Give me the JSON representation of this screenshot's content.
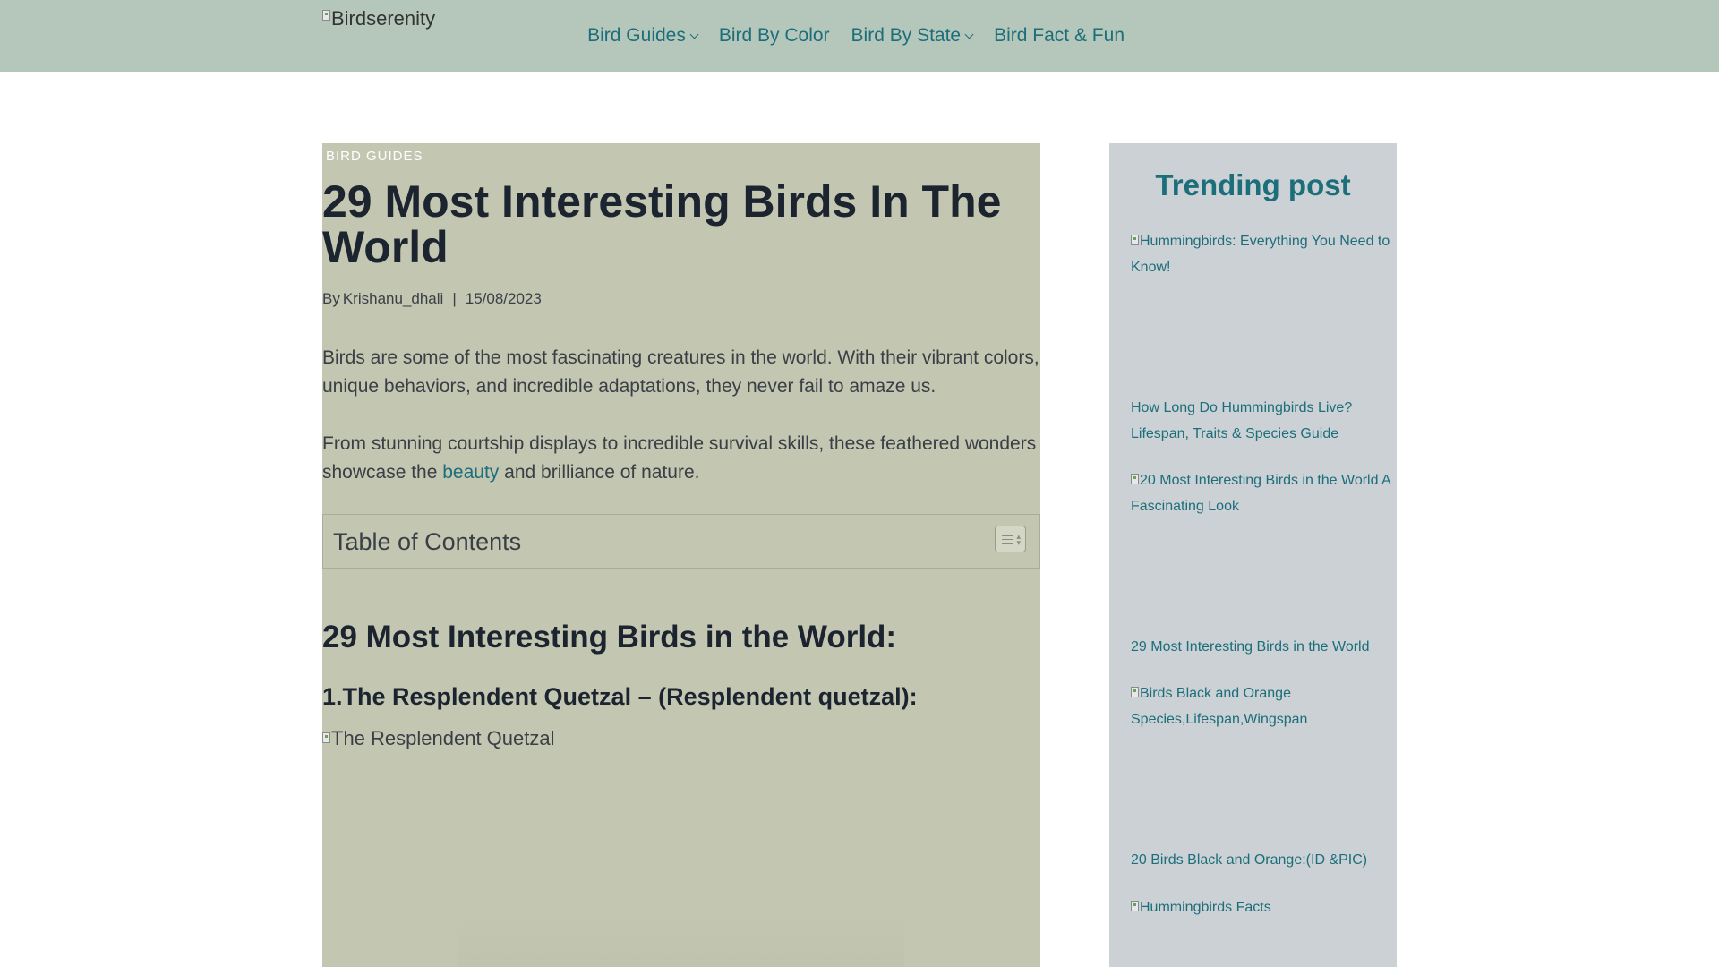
{
  "header": {
    "logo_alt": "Birdserenity",
    "nav": [
      {
        "label": "Bird Guides",
        "has_dropdown": true
      },
      {
        "label": "Bird By Color",
        "has_dropdown": false
      },
      {
        "label": "Bird By State",
        "has_dropdown": true
      },
      {
        "label": "Bird Fact & Fun",
        "has_dropdown": false
      }
    ]
  },
  "article": {
    "category": "BIRD GUIDES",
    "title": "29 Most Interesting Birds In The World",
    "meta": {
      "by": "By",
      "author": "Krishanu_dhali",
      "separator": "|",
      "date": "15/08/2023"
    },
    "para1": "Birds are some of the most fascinating creatures in the world. With their vibrant colors, unique behaviors, and incredible adaptations, they never fail to amaze us.",
    "para2_before": "From stunning courtship displays to incredible survival skills, these feathered wonders showcase the ",
    "para2_link": "beauty",
    "para2_after": " and brilliance of nature.",
    "toc_title": "Table of Contents",
    "h2": "29 Most Interesting Birds in the World:",
    "h3": "1.The Resplendent Quetzal – (Resplendent quetzal):",
    "image_alt": "The Resplendent Quetzal"
  },
  "sidebar": {
    "title": "Trending post",
    "items": [
      {
        "image_alt": "Hummingbirds: Everything You Need to Know!",
        "link": "How Long Do Hummingbirds Live? Lifespan, Traits & Species Guide"
      },
      {
        "image_alt": "20 Most Interesting Birds in the World A Fascinating Look",
        "link": "29 Most Interesting Birds in the World"
      },
      {
        "image_alt": "Birds Black and Orange Species,Lifespan,Wingspan",
        "link": "20 Birds Black and Orange:(ID &PIC)"
      },
      {
        "image_alt": "Hummingbirds Facts",
        "link": ""
      }
    ]
  },
  "colors": {
    "header_bg": "#b5c6bb",
    "article_bg": "#c3c6b1",
    "sidebar_bg": "#cbd1d5",
    "accent": "#1c6e7a",
    "heading": "#1c2430"
  }
}
